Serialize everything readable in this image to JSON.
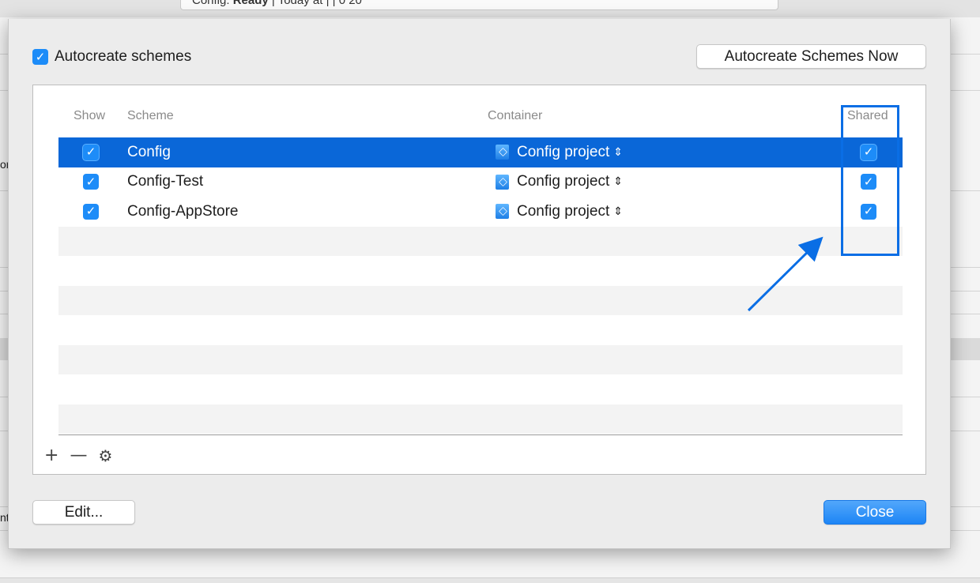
{
  "background": {
    "status_prefix": "Config: ",
    "status_state": "Ready",
    "status_rest": "  |  Today at  |  | 0 20",
    "fragment_1": "on",
    "fragment_2": "nt"
  },
  "sheet": {
    "autocreate_label": "Autocreate schemes",
    "autocreate_checked": true,
    "autocreate_now_button": "Autocreate Schemes Now",
    "edit_button": "Edit...",
    "close_button": "Close"
  },
  "table": {
    "headers": {
      "show": "Show",
      "scheme": "Scheme",
      "container": "Container",
      "shared": "Shared"
    },
    "rows": [
      {
        "show": true,
        "scheme": "Config",
        "container": "Config project",
        "shared": true,
        "selected": true
      },
      {
        "show": true,
        "scheme": "Config-Test",
        "container": "Config project",
        "shared": true,
        "selected": false
      },
      {
        "show": true,
        "scheme": "Config-AppStore",
        "container": "Config project",
        "shared": true,
        "selected": false
      }
    ],
    "tools": {
      "add": "+",
      "remove": "—",
      "settings": "⚙"
    }
  },
  "icons": {
    "check": "checkmark-icon",
    "project": "xcode-project-icon",
    "popup": "up-down-chevron-icon",
    "gear": "gear-icon"
  },
  "colors": {
    "accent": "#1d8cf8",
    "selection": "#0a67d8",
    "annotation": "#0a6ee5"
  }
}
